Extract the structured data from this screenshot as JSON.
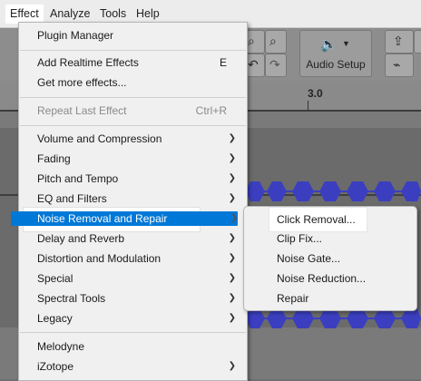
{
  "menubar": {
    "items": [
      "Effect",
      "Analyze",
      "Tools",
      "Help"
    ],
    "active_index": 0
  },
  "background": {
    "audio_setup_label": "Audio Setup",
    "ruler_tick": "3.0"
  },
  "effect_menu": {
    "plugin_manager": "Plugin Manager",
    "add_realtime_effects": "Add Realtime Effects",
    "add_realtime_shortcut": "E",
    "get_more_effects": "Get more effects...",
    "repeat_last_effect": "Repeat Last Effect",
    "repeat_last_shortcut": "Ctrl+R",
    "volume_compression": "Volume and Compression",
    "fading": "Fading",
    "pitch_tempo": "Pitch and Tempo",
    "eq_filters": "EQ and Filters",
    "noise_removal_repair": "Noise Removal and Repair",
    "delay_reverb": "Delay and Reverb",
    "distortion_modulation": "Distortion and Modulation",
    "special": "Special",
    "spectral_tools": "Spectral Tools",
    "legacy": "Legacy",
    "melodyne": "Melodyne",
    "izotope": "iZotope"
  },
  "noise_submenu": {
    "click_removal": "Click Removal...",
    "clip_fix": "Clip Fix...",
    "noise_gate": "Noise Gate...",
    "noise_reduction": "Noise Reduction...",
    "repair": "Repair"
  },
  "colors": {
    "highlight": "#0078d7",
    "waveform": "#3b3fbf",
    "menu_bg": "#f0f0f0"
  }
}
